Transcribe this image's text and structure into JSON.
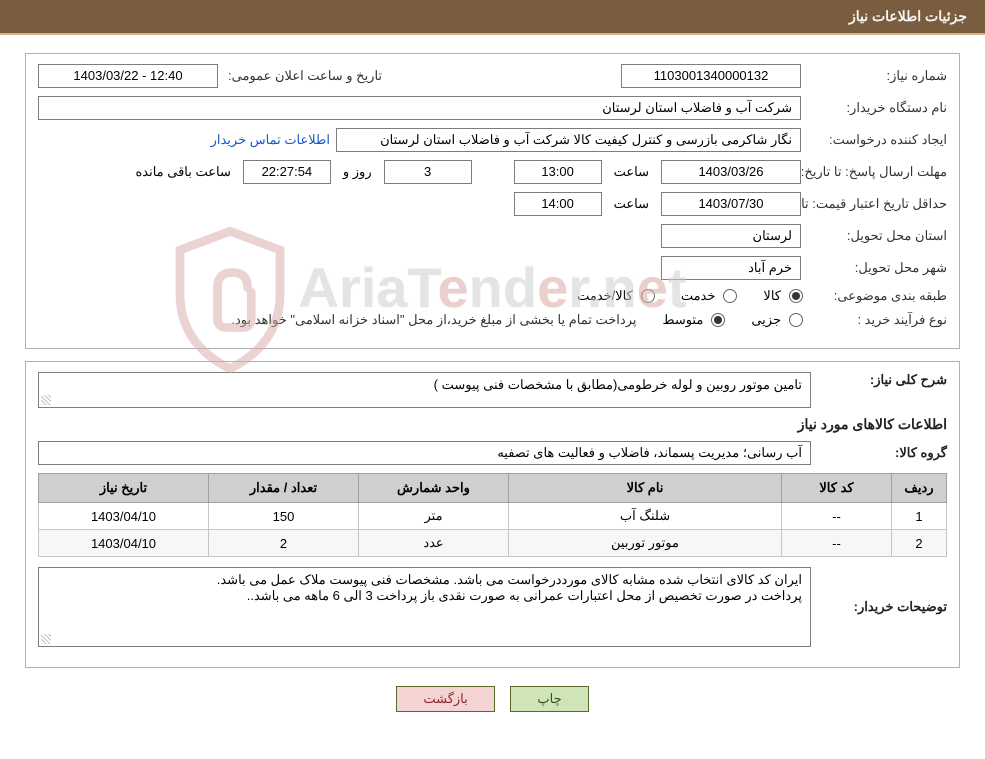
{
  "header": {
    "title": "جزئیات اطلاعات نیاز"
  },
  "panel1": {
    "need_no_label": "شماره نیاز:",
    "need_no": "1103001340000132",
    "announce_label": "تاریخ و ساعت اعلان عمومی:",
    "announce_value": "1403/03/22 - 12:40",
    "buyer_org_label": "نام دستگاه خریدار:",
    "buyer_org": "شرکت آب و فاضلاب استان لرستان",
    "requester_label": "ایجاد کننده درخواست:",
    "requester": "نگار شاکرمی بازرسی و کنترل کیفیت کالا شرکت آب و فاضلاب استان لرستان",
    "contact_link": "اطلاعات تماس خریدار",
    "deadline_label": "مهلت ارسال پاسخ:",
    "until_date_label": "تا تاریخ:",
    "deadline_date": "1403/03/26",
    "time_label": "ساعت",
    "deadline_time": "13:00",
    "days_value": "3",
    "days_and": "روز و",
    "countdown": "22:27:54",
    "remaining": "ساعت باقی مانده",
    "validity_label": "حداقل تاریخ اعتبار قیمت:",
    "validity_date": "1403/07/30",
    "validity_time": "14:00",
    "province_label": "استان محل تحویل:",
    "province": "لرستان",
    "city_label": "شهر محل تحویل:",
    "city": "خرم آباد",
    "category_label": "طبقه بندی موضوعی:",
    "cat_goods": "کالا",
    "cat_service": "خدمت",
    "cat_goods_service": "کالا/خدمت",
    "process_label": "نوع فرآیند خرید :",
    "proc_partial": "جزیی",
    "proc_medium": "متوسط",
    "process_note": "پرداخت تمام یا بخشی از مبلغ خرید،از محل \"اسناد خزانه اسلامی\" خواهد بود."
  },
  "panel2": {
    "desc_label": "شرح کلی نیاز:",
    "desc_text": "تامین موتور روبین و لوله خرطومی(مطابق با مشخصات فنی پیوست )",
    "items_title": "اطلاعات کالاهای مورد نیاز",
    "group_label": "گروه کالا:",
    "group_text": "آب رسانی؛ مدیریت پسماند، فاضلاب و فعالیت های تصفیه",
    "table": {
      "headers": {
        "idx": "ردیف",
        "code": "کد کالا",
        "name": "نام کالا",
        "unit": "واحد شمارش",
        "qty": "تعداد / مقدار",
        "date": "تاریخ نیاز"
      },
      "rows": [
        {
          "idx": "1",
          "code": "--",
          "name": "شلنگ آب",
          "unit": "متر",
          "qty": "150",
          "date": "1403/04/10"
        },
        {
          "idx": "2",
          "code": "--",
          "name": "موتور توربین",
          "unit": "عدد",
          "qty": "2",
          "date": "1403/04/10"
        }
      ]
    },
    "buyer_notes_label": "توضیحات خریدار:",
    "buyer_notes": "ایران کد کالای انتخاب شده مشابه کالای مورددرخواست می باشد. مشخصات فنی پیوست ملاک عمل می باشد.\nپرداخت در صورت تخصیص از محل اعتبارات عمرانی  به صورت نقدی باز پرداخت  3 الی 6 ماهه می باشد.."
  },
  "buttons": {
    "print": "چاپ",
    "back": "بازگشت"
  },
  "watermark": {
    "pre": "AriaT",
    "red_e": "e",
    "mid": "nd",
    "red_e2": "e",
    "post": "r.n",
    "red_e3": "e",
    "tail": "t"
  }
}
